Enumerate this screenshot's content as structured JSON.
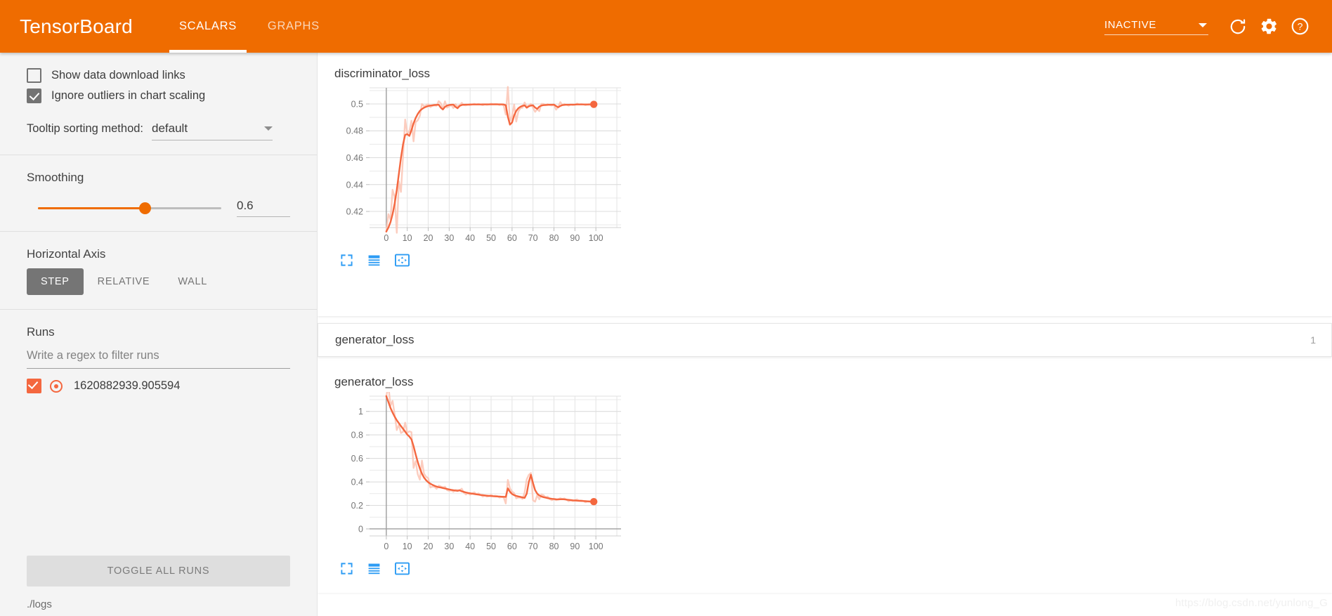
{
  "header": {
    "brand": "TensorBoard",
    "tabs": [
      {
        "label": "SCALARS",
        "active": true
      },
      {
        "label": "GRAPHS",
        "active": false
      }
    ],
    "run_selector_value": "INACTIVE",
    "icons": [
      "refresh-icon",
      "settings-gear-icon",
      "help-question-icon"
    ]
  },
  "sidebar": {
    "checkboxes": [
      {
        "label": "Show data download links",
        "checked": false
      },
      {
        "label": "Ignore outliers in chart scaling",
        "checked": true
      }
    ],
    "tooltip_sorting": {
      "label": "Tooltip sorting method:",
      "value": "default"
    },
    "smoothing": {
      "title": "Smoothing",
      "value": "0.6",
      "fraction": 0.6
    },
    "horizontal_axis": {
      "title": "Horizontal Axis",
      "options": [
        "STEP",
        "RELATIVE",
        "WALL"
      ],
      "selected": "STEP"
    },
    "runs": {
      "title": "Runs",
      "filter_placeholder": "Write a regex to filter runs",
      "items": [
        {
          "name": "1620882939.905594",
          "checked": true,
          "color": "#f4673f"
        }
      ],
      "toggle_all_label": "TOGGLE ALL RUNS"
    },
    "logdir": "./logs"
  },
  "main": {
    "section": {
      "title": "generator_loss",
      "count": "1"
    },
    "chart_toolbar": [
      "expand-chart-icon",
      "data-table-icon",
      "fit-domain-icon"
    ],
    "watermark": "https://blog.csdn.net/yunlong_G"
  },
  "colors": {
    "brand_orange": "#ef6c00",
    "series_orange": "#f4673f",
    "series_faded": "#fbc4b4",
    "grid": "#e0e0e0"
  },
  "chart_data": [
    {
      "type": "line",
      "title": "discriminator_loss",
      "xlabel": "",
      "ylabel": "",
      "xlim": [
        -8,
        112
      ],
      "ylim": [
        0.408,
        0.512
      ],
      "xticks": [
        0,
        10,
        20,
        30,
        40,
        50,
        60,
        70,
        80,
        90,
        100
      ],
      "yticks": [
        0.42,
        0.44,
        0.46,
        0.48,
        0.5
      ],
      "ytick_labels": [
        "0.42",
        "0.44",
        "0.46",
        "0.48",
        "0.5"
      ],
      "grid": true,
      "legend": false,
      "smoothing": 0.6,
      "series": [
        {
          "name": "1620882939.905594",
          "color": "#f4673f",
          "x": [
            0,
            1,
            2,
            3,
            4,
            5,
            6,
            7,
            8,
            9,
            10,
            11,
            12,
            13,
            14,
            15,
            16,
            17,
            18,
            19,
            20,
            21,
            22,
            23,
            24,
            25,
            26,
            27,
            28,
            29,
            30,
            31,
            32,
            33,
            34,
            35,
            36,
            37,
            38,
            39,
            40,
            41,
            42,
            43,
            44,
            45,
            46,
            47,
            48,
            49,
            50,
            51,
            52,
            53,
            54,
            55,
            56,
            57,
            58,
            59,
            60,
            61,
            62,
            63,
            64,
            65,
            66,
            67,
            68,
            69,
            70,
            71,
            72,
            73,
            74,
            75,
            76,
            77,
            78,
            79,
            80,
            81,
            82,
            83,
            84,
            85,
            86,
            87,
            88,
            89,
            90,
            91,
            92,
            93,
            94,
            95,
            96,
            97,
            98,
            99
          ],
          "y": [
            0.405,
            0.408,
            0.412,
            0.418,
            0.426,
            0.436,
            0.448,
            0.46,
            0.47,
            0.477,
            0.4775,
            0.4762,
            0.4805,
            0.4855,
            0.4895,
            0.4925,
            0.4948,
            0.4962,
            0.4972,
            0.4979,
            0.4984,
            0.4988,
            0.499,
            0.4992,
            0.4993,
            0.4994,
            0.4972,
            0.4959,
            0.4978,
            0.4988,
            0.4992,
            0.4994,
            0.4995,
            0.4978,
            0.4968,
            0.4985,
            0.4992,
            0.4994,
            0.4995,
            0.4995,
            0.4996,
            0.4996,
            0.4996,
            0.4996,
            0.4996,
            0.4996,
            0.4997,
            0.4997,
            0.4997,
            0.4997,
            0.4997,
            0.4997,
            0.4997,
            0.4997,
            0.4997,
            0.4997,
            0.4996,
            0.499,
            0.4905,
            0.4846,
            0.4862,
            0.4915,
            0.4948,
            0.4968,
            0.4979,
            0.4986,
            0.4989,
            0.4972,
            0.4982,
            0.4988,
            0.499,
            0.4973,
            0.4963,
            0.498,
            0.4988,
            0.4991,
            0.4992,
            0.4993,
            0.4994,
            0.4994,
            0.4995,
            0.4984,
            0.4975,
            0.4985,
            0.4991,
            0.4993,
            0.4994,
            0.4994,
            0.4995,
            0.4995,
            0.4995,
            0.4996,
            0.4996,
            0.4996,
            0.4996,
            0.4996,
            0.4996,
            0.4997,
            0.4997,
            0.4997
          ],
          "last_point": {
            "x": 99,
            "y": 0.4997
          }
        }
      ]
    },
    {
      "type": "line",
      "title": "generator_loss",
      "xlabel": "",
      "ylabel": "",
      "xlim": [
        -8,
        112
      ],
      "ylim": [
        -0.06,
        1.13
      ],
      "xticks": [
        0,
        10,
        20,
        30,
        40,
        50,
        60,
        70,
        80,
        90,
        100
      ],
      "yticks": [
        0,
        0.2,
        0.4,
        0.6,
        0.8,
        1
      ],
      "ytick_labels": [
        "0",
        "0.2",
        "0.4",
        "0.6",
        "0.8",
        "1"
      ],
      "grid": true,
      "legend": false,
      "smoothing": 0.6,
      "series": [
        {
          "name": "1620882939.905594",
          "color": "#f4673f",
          "x": [
            0,
            1,
            2,
            3,
            4,
            5,
            6,
            7,
            8,
            9,
            10,
            11,
            12,
            13,
            14,
            15,
            16,
            17,
            18,
            19,
            20,
            21,
            22,
            23,
            24,
            25,
            26,
            27,
            28,
            29,
            30,
            31,
            32,
            33,
            34,
            35,
            36,
            37,
            38,
            39,
            40,
            41,
            42,
            43,
            44,
            45,
            46,
            47,
            48,
            49,
            50,
            51,
            52,
            53,
            54,
            55,
            56,
            57,
            58,
            59,
            60,
            61,
            62,
            63,
            64,
            65,
            66,
            67,
            68,
            69,
            70,
            71,
            72,
            73,
            74,
            75,
            76,
            77,
            78,
            79,
            80,
            81,
            82,
            83,
            84,
            85,
            86,
            87,
            88,
            89,
            90,
            91,
            92,
            93,
            94,
            95,
            96,
            97,
            98,
            99
          ],
          "y": [
            1.13,
            1.08,
            1.03,
            0.99,
            0.955,
            0.925,
            0.9,
            0.875,
            0.852,
            0.828,
            0.803,
            0.786,
            0.762,
            0.705,
            0.635,
            0.57,
            0.515,
            0.47,
            0.437,
            0.414,
            0.397,
            0.385,
            0.375,
            0.367,
            0.36,
            0.355,
            0.352,
            0.348,
            0.344,
            0.34,
            0.336,
            0.332,
            0.329,
            0.326,
            0.324,
            0.328,
            0.32,
            0.315,
            0.31,
            0.306,
            0.303,
            0.3,
            0.297,
            0.294,
            0.292,
            0.289,
            0.287,
            0.285,
            0.283,
            0.281,
            0.28,
            0.278,
            0.277,
            0.276,
            0.275,
            0.274,
            0.273,
            0.272,
            0.345,
            0.316,
            0.297,
            0.287,
            0.281,
            0.276,
            0.272,
            0.268,
            0.264,
            0.3,
            0.4,
            0.46,
            0.39,
            0.33,
            0.3,
            0.285,
            0.276,
            0.27,
            0.266,
            0.262,
            0.259,
            0.256,
            0.254,
            0.252,
            0.251,
            0.252,
            0.253,
            0.251,
            0.249,
            0.247,
            0.245,
            0.243,
            0.242,
            0.24,
            0.239,
            0.238,
            0.237,
            0.236,
            0.235,
            0.234,
            0.233,
            0.232
          ],
          "last_point": {
            "x": 99,
            "y": 0.232
          }
        }
      ]
    }
  ]
}
